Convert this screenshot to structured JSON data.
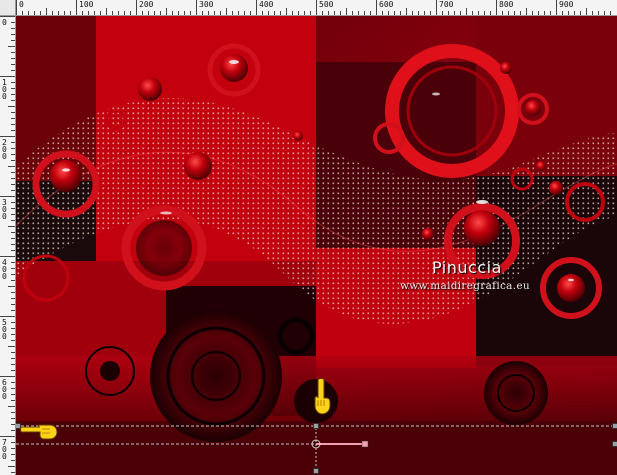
{
  "ruler": {
    "top_labels": [
      "0",
      "100",
      "200",
      "300",
      "400",
      "500",
      "600",
      "700",
      "800",
      "900"
    ],
    "left_labels": [
      "0",
      "100",
      "200",
      "300",
      "400",
      "500",
      "600",
      "700"
    ]
  },
  "watermark": {
    "name": "Pinuccia",
    "url": "www.maidiregrafica.eu"
  },
  "colors": {
    "background_dark": "#2a0006",
    "red_main": "#c0000e",
    "red_bright": "#e8101a",
    "selection_line": "#c8c8c8"
  },
  "icons": {
    "pointer_down": "pointing-hand-down-icon",
    "pointer_left": "pointing-hand-left-icon"
  }
}
